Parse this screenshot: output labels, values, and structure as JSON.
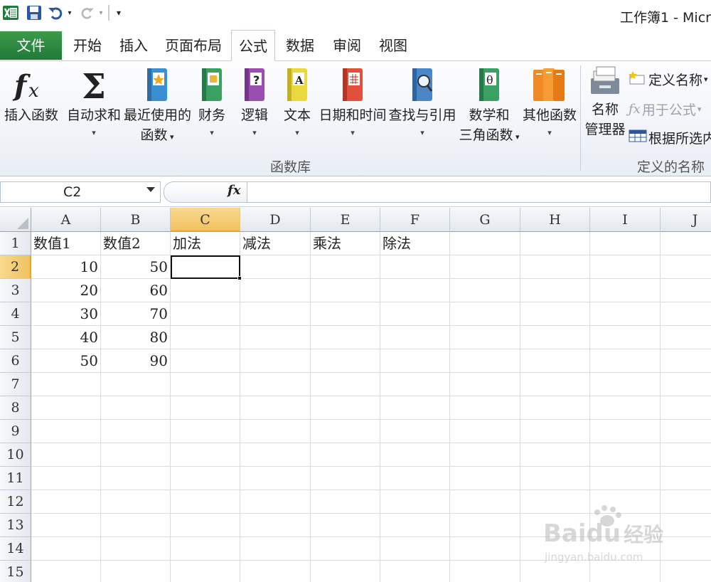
{
  "window": {
    "title": "工作簿1 - Micr"
  },
  "tabs": [
    {
      "id": "file",
      "label": "文件"
    },
    {
      "id": "home",
      "label": "开始"
    },
    {
      "id": "insert",
      "label": "插入"
    },
    {
      "id": "page_layout",
      "label": "页面布局"
    },
    {
      "id": "formulas",
      "label": "公式",
      "active": true
    },
    {
      "id": "data",
      "label": "数据"
    },
    {
      "id": "review",
      "label": "审阅"
    },
    {
      "id": "view",
      "label": "视图"
    }
  ],
  "ribbon": {
    "function_library": {
      "group_label": "函数库",
      "insert_function": "插入函数",
      "autosum": "自动求和",
      "recently_used": [
        "最近使用的",
        "函数"
      ],
      "financial": "财务",
      "logical": "逻辑",
      "text": "文本",
      "date_time": "日期和时间",
      "lookup": "查找与引用",
      "math_trig": [
        "数学和",
        "三角函数"
      ],
      "more_functions": "其他函数"
    },
    "defined_names": {
      "group_label": "定义的名称",
      "name_manager": [
        "名称",
        "管理器"
      ],
      "define_name": "定义名称",
      "use_in_formula": "用于公式",
      "create_from_selection": "根据所选内"
    }
  },
  "formula_bar": {
    "name_box": "C2",
    "fx": "fx",
    "value": ""
  },
  "sheet": {
    "columns": [
      "A",
      "B",
      "C",
      "D",
      "E",
      "F",
      "G",
      "H",
      "I",
      "J"
    ],
    "rows": [
      "1",
      "2",
      "3",
      "4",
      "5",
      "6",
      "7",
      "8",
      "9",
      "10",
      "11",
      "12",
      "13",
      "14",
      "15"
    ],
    "selected_col": "C",
    "selected_row": "2",
    "headers": [
      "数值1",
      "数值2",
      "加法",
      "减法",
      "乘法",
      "除法"
    ],
    "values_a": [
      "10",
      "20",
      "30",
      "40",
      "50"
    ],
    "values_b": [
      "50",
      "60",
      "70",
      "80",
      "90"
    ]
  },
  "watermark": {
    "brand": "Bai",
    "brand2": "du",
    "cn": "经验",
    "url": "jingyan.baidu.com"
  },
  "colors": {
    "file_tab": "#2e8b43",
    "selected_header": "#f1c15f",
    "grid_line": "#dadcdd"
  }
}
